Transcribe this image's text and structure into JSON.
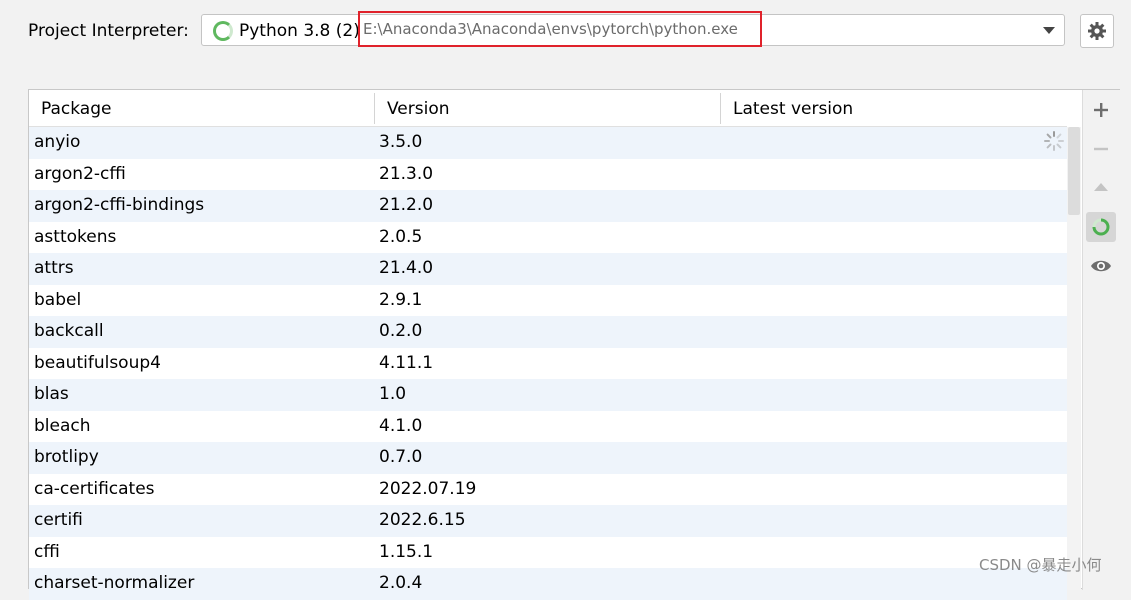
{
  "interpreter": {
    "label": "Project Interpreter:",
    "name": "Python 3.8 (2)",
    "path": "E:\\Anaconda3\\Anaconda\\envs\\pytorch\\python.exe"
  },
  "table": {
    "columns": [
      "Package",
      "Version",
      "Latest version"
    ],
    "rows": [
      {
        "package": "anyio",
        "version": "3.5.0",
        "latest": ""
      },
      {
        "package": "argon2-cffi",
        "version": "21.3.0",
        "latest": ""
      },
      {
        "package": "argon2-cffi-bindings",
        "version": "21.2.0",
        "latest": ""
      },
      {
        "package": "asttokens",
        "version": "2.0.5",
        "latest": ""
      },
      {
        "package": "attrs",
        "version": "21.4.0",
        "latest": ""
      },
      {
        "package": "babel",
        "version": "2.9.1",
        "latest": ""
      },
      {
        "package": "backcall",
        "version": "0.2.0",
        "latest": ""
      },
      {
        "package": "beautifulsoup4",
        "version": "4.11.1",
        "latest": ""
      },
      {
        "package": "blas",
        "version": "1.0",
        "latest": ""
      },
      {
        "package": "bleach",
        "version": "4.1.0",
        "latest": ""
      },
      {
        "package": "brotlipy",
        "version": "0.7.0",
        "latest": ""
      },
      {
        "package": "ca-certificates",
        "version": "2022.07.19",
        "latest": ""
      },
      {
        "package": "certifi",
        "version": "2022.6.15",
        "latest": ""
      },
      {
        "package": "cffi",
        "version": "1.15.1",
        "latest": ""
      },
      {
        "package": "charset-normalizer",
        "version": "2.0.4",
        "latest": ""
      }
    ]
  },
  "toolbar": {
    "buttons": [
      "plus-icon",
      "minus-icon",
      "upgrade-arrow-icon",
      "loading-spinner-icon",
      "eye-icon"
    ]
  },
  "watermark": "CSDN @暴走小何"
}
